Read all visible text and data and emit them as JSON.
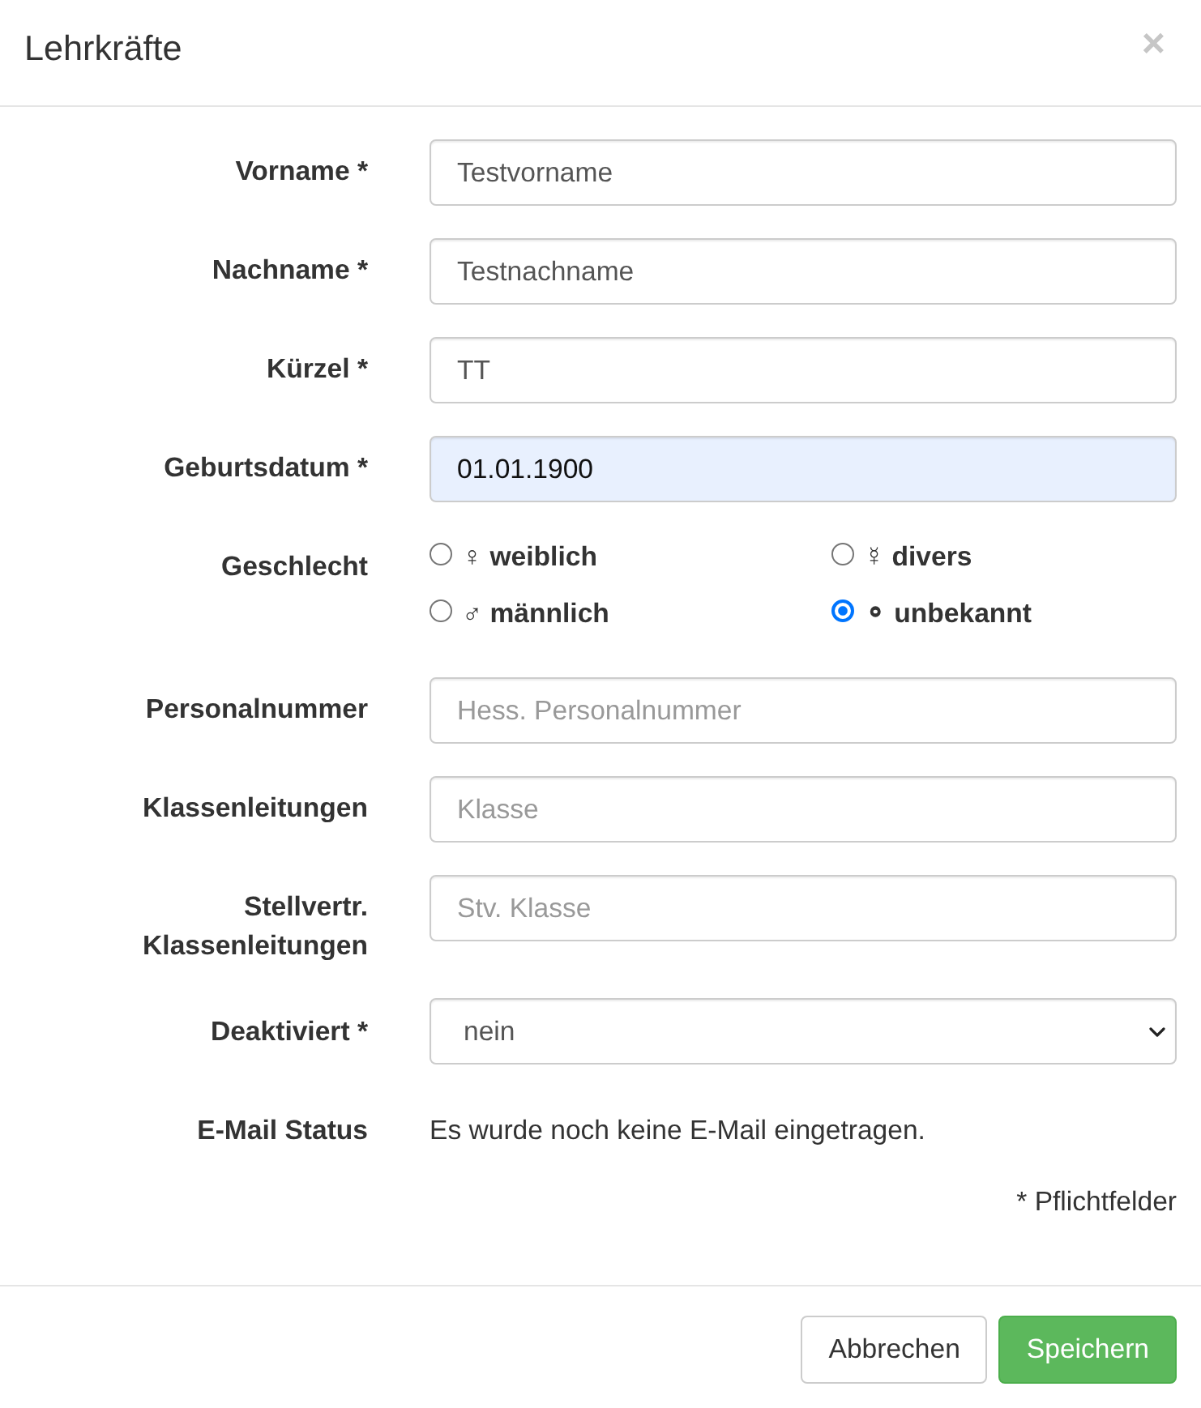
{
  "dialog": {
    "title": "Lehrkräfte",
    "close": "×"
  },
  "fields": [
    {
      "kind": "text",
      "label": "Vorname *",
      "value": "Testvorname",
      "autofilled": false
    },
    {
      "kind": "text",
      "label": "Nachname *",
      "value": "Testnachname",
      "autofilled": false
    },
    {
      "kind": "text",
      "label": "Kürzel *",
      "value": "TT",
      "autofilled": false
    },
    {
      "kind": "text",
      "label": "Geburtsdatum *",
      "value": "01.01.1900",
      "autofilled": true
    },
    {
      "kind": "radio",
      "label": "Geschlecht",
      "options": [
        {
          "label": "♀ weiblich",
          "selected": false
        },
        {
          "label": "☿ divers",
          "selected": false
        },
        {
          "label": "♂ männlich",
          "selected": false
        },
        {
          "label": "⚬ unbekannt",
          "selected": true
        }
      ]
    },
    {
      "kind": "text",
      "label": "Personalnummer",
      "placeholder": "Hess. Personalnummer",
      "autofilled": false
    },
    {
      "kind": "text",
      "label": "Klassenleitungen",
      "placeholder": "Klasse",
      "autofilled": false
    },
    {
      "kind": "text",
      "label": "Stellvertr. Klassenleitungen",
      "placeholder": "Stv. Klasse",
      "autofilled": false
    },
    {
      "kind": "select",
      "label": "Deaktiviert *",
      "value": "nein"
    },
    {
      "kind": "static",
      "label": "E-Mail Status",
      "text": "Es wurde noch keine E-Mail eingetragen."
    }
  ],
  "required_note": "* Pflichtfelder",
  "buttons": [
    {
      "kind": "default",
      "label": "Abbrechen"
    },
    {
      "kind": "primary",
      "label": "Speichern"
    }
  ]
}
